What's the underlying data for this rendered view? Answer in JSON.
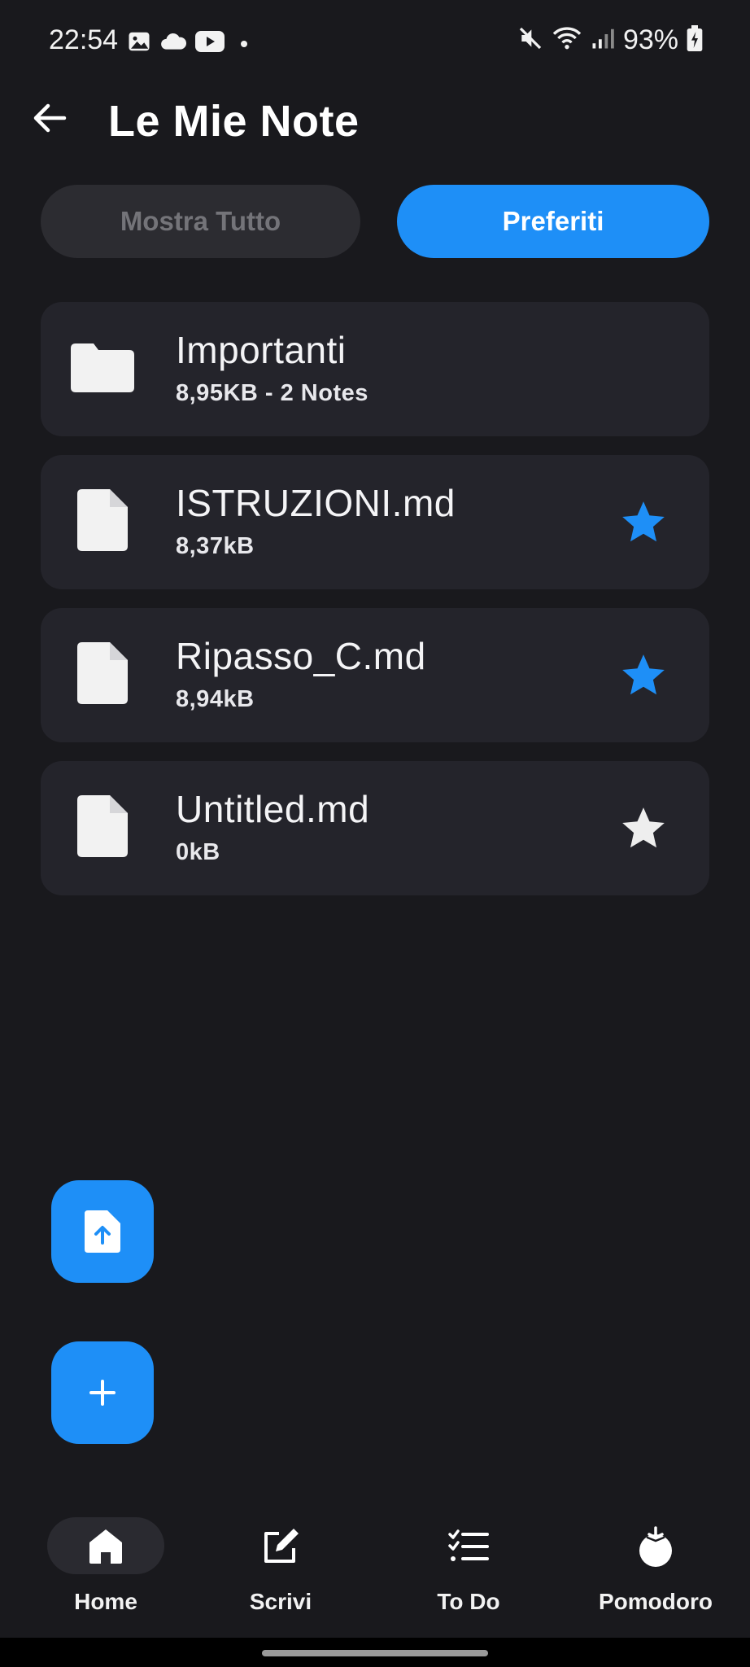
{
  "status_bar": {
    "time": "22:54",
    "battery": "93%",
    "left_icons": [
      "image-icon",
      "cloud-icon",
      "youtube-icon",
      "dot-icon"
    ],
    "right_icons": [
      "mute-icon",
      "wifi-icon",
      "signal-icon",
      "battery-charging-icon"
    ]
  },
  "header": {
    "title": "Le Mie Note",
    "back_icon": "arrow-back-icon"
  },
  "filters": {
    "show_all_label": "Mostra Tutto",
    "favorites_label": "Preferiti",
    "active": "favorites"
  },
  "items": [
    {
      "type": "folder",
      "title": "Importanti",
      "subtitle": "8,95KB - 2 Notes",
      "icon": "folder-icon",
      "favorite": null
    },
    {
      "type": "file",
      "title": "ISTRUZIONI.md",
      "subtitle": "8,37kB",
      "icon": "file-icon",
      "favorite": true
    },
    {
      "type": "file",
      "title": "Ripasso_C.md",
      "subtitle": "8,94kB",
      "icon": "file-icon",
      "favorite": true
    },
    {
      "type": "file",
      "title": "Untitled.md",
      "subtitle": "0kB",
      "icon": "file-icon",
      "favorite": false
    }
  ],
  "fabs": {
    "upload_icon": "file-upload-icon",
    "add_icon": "plus-icon"
  },
  "bottom_nav": [
    {
      "label": "Home",
      "icon": "home-icon",
      "active": true
    },
    {
      "label": "Scrivi",
      "icon": "edit-icon",
      "active": false
    },
    {
      "label": "To Do",
      "icon": "checklist-icon",
      "active": false
    },
    {
      "label": "Pomodoro",
      "icon": "tomato-icon",
      "active": false
    }
  ],
  "colors": {
    "background": "#19191d",
    "card": "#24242b",
    "accent": "#1e8ff7",
    "inactive_button": "#2c2c31"
  }
}
